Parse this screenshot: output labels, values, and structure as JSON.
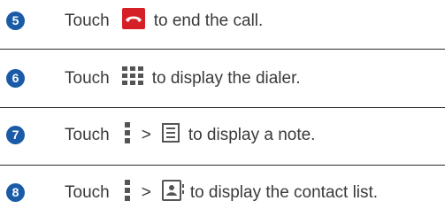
{
  "steps": [
    {
      "number": "5",
      "touch": "Touch",
      "text": "to end the call.",
      "icons": [
        "end-call-icon"
      ]
    },
    {
      "number": "6",
      "touch": "Touch",
      "text": "to display the dialer.",
      "icons": [
        "dialpad-icon"
      ]
    },
    {
      "number": "7",
      "touch": "Touch",
      "separator": ">",
      "text": "to display a note.",
      "icons": [
        "menu-more-icon",
        "note-icon"
      ]
    },
    {
      "number": "8",
      "touch": "Touch",
      "separator": ">",
      "text": "to display the contact list.",
      "icons": [
        "menu-more-icon",
        "contact-card-icon"
      ]
    }
  ],
  "colors": {
    "badge": "#1a5ba8",
    "end_call_red": "#d62027",
    "icon_gray": "#555555",
    "text": "#3a3a3a"
  }
}
